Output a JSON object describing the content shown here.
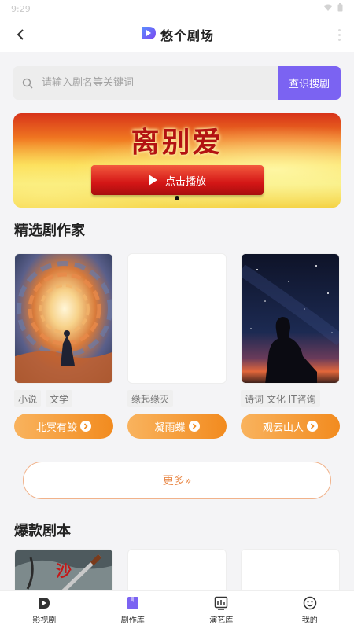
{
  "status_bar": {
    "time": "9:29"
  },
  "header": {
    "title": "悠个剧场"
  },
  "search": {
    "placeholder": "请输入剧名等关键词",
    "button_label": "查识搜剧"
  },
  "banner": {
    "title": "离别爱",
    "play_label": "点击播放"
  },
  "featured_writers": {
    "title": "精选剧作家",
    "writers": [
      {
        "name": "北冥有鲛",
        "tags": [
          "小说",
          "文学"
        ]
      },
      {
        "name": "凝雨蝶",
        "tags": [
          "缘起缘灭"
        ]
      },
      {
        "name": "观云山人",
        "tags": [
          "诗词 文化 IT咨询"
        ]
      }
    ],
    "more_label": "更多»"
  },
  "hot_scripts": {
    "title": "爆款剧本"
  },
  "tabbar": {
    "items": [
      {
        "label": "影视剧",
        "icon": "logo-icon"
      },
      {
        "label": "剧作库",
        "icon": "bookmark-icon"
      },
      {
        "label": "演艺库",
        "icon": "chart-icon"
      },
      {
        "label": "我的",
        "icon": "smiley-icon"
      }
    ]
  },
  "colors": {
    "accent": "#7b63f2",
    "orange": "#f28b1f",
    "banner_red": "#d41616"
  }
}
